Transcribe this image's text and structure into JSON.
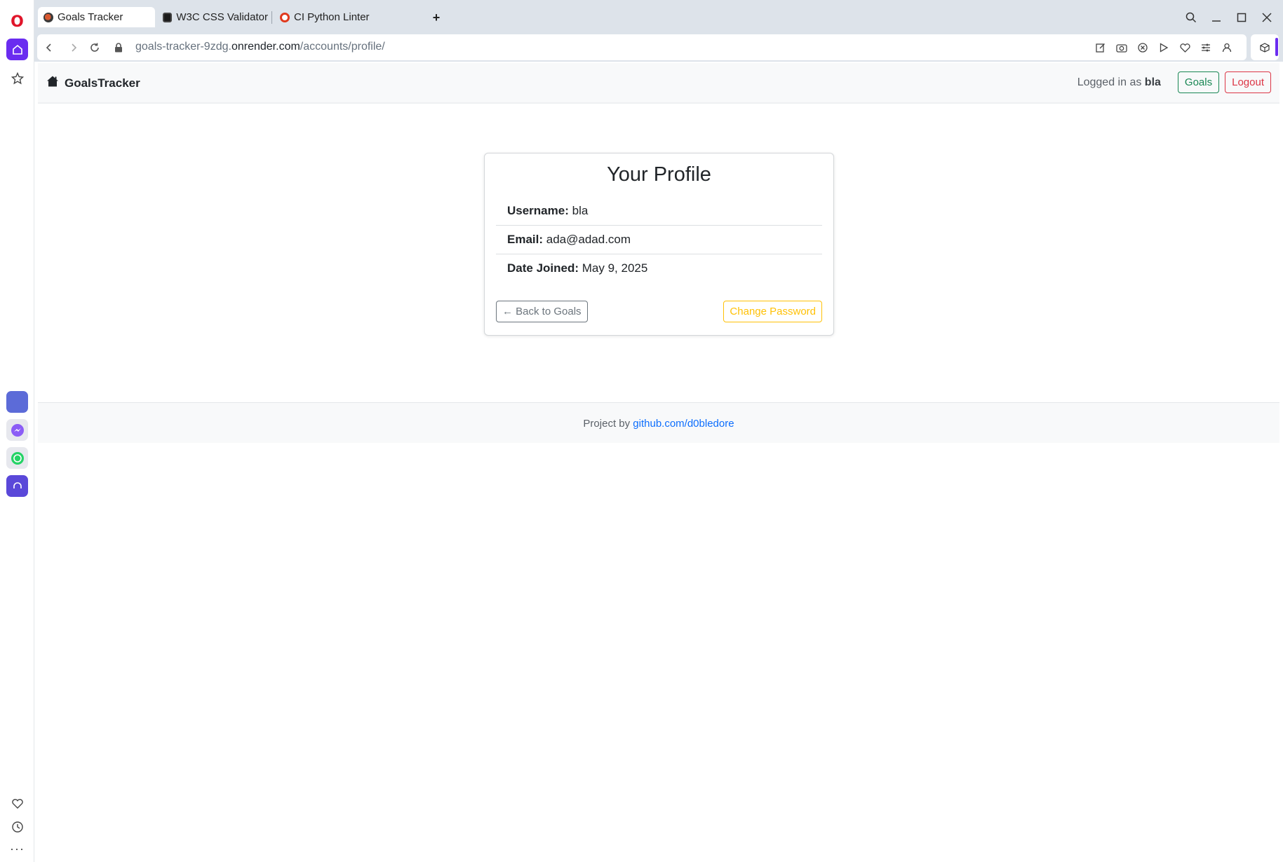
{
  "browser": {
    "tabs": [
      {
        "label": "Goals Tracker",
        "active": true
      },
      {
        "label": "W3C CSS Validator"
      },
      {
        "label": "CI Python Linter"
      }
    ],
    "new_tab_icon": "plus-icon",
    "url": {
      "prefix": "goals-tracker-9zdg.",
      "host": "onrender.com",
      "path": "/accounts/profile/"
    }
  },
  "sidebar": {
    "icons": [
      "opera-logo",
      "home-icon",
      "star-icon",
      "aria-icon",
      "messenger-icon",
      "whatsapp-icon",
      "music-icon",
      "heart-icon",
      "clock-icon",
      "more-icon"
    ],
    "accent": "#6a2cf0"
  },
  "page": {
    "navbar": {
      "brand": "GoalsTracker",
      "logged_prefix": "Logged in as",
      "username": "bla",
      "goals_button": "Goals",
      "logout_button": "Logout"
    },
    "profile": {
      "title": "Your Profile",
      "fields": [
        {
          "label": "Username:",
          "value": "bla"
        },
        {
          "label": "Email:",
          "value": "ada@adad.com"
        },
        {
          "label": "Date Joined:",
          "value": "May 9, 2025"
        }
      ],
      "back_button": "← Back to Goals",
      "change_password_button": "Change Password"
    },
    "footer": {
      "text": "Project by",
      "link": "github.com/d0bledore"
    }
  },
  "colors": {
    "success": "#198754",
    "danger": "#dc3545",
    "warning": "#ffc107",
    "secondary": "#6c757d",
    "link": "#0d6efd"
  }
}
